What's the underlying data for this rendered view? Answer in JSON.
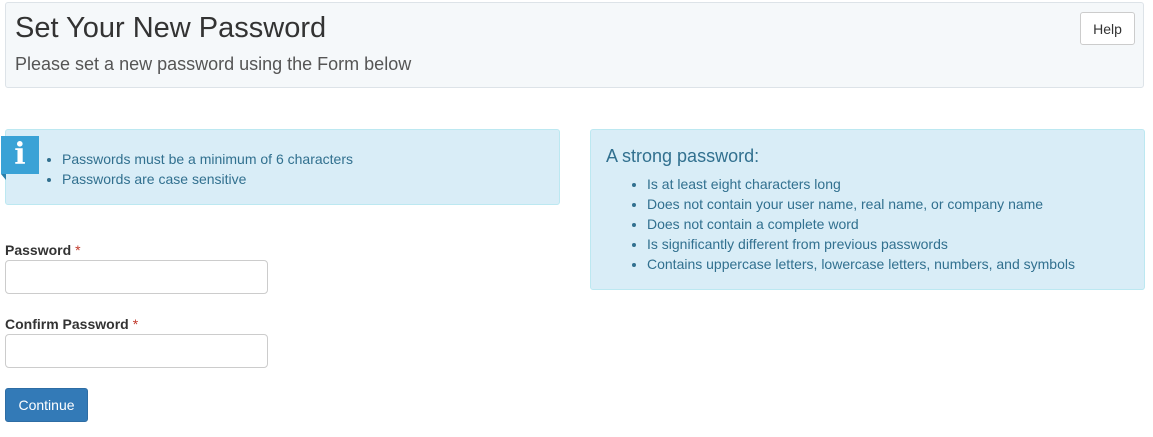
{
  "header": {
    "title": "Set Your New Password",
    "subtitle": "Please set a new password using the Form below",
    "help_label": "Help"
  },
  "info": {
    "icon": "info-icon",
    "icon_glyph": "i",
    "items": [
      "Passwords must be a minimum of 6 characters",
      "Passwords are case sensitive"
    ]
  },
  "strong_password": {
    "title": "A strong password:",
    "items": [
      "Is at least eight characters long",
      "Does not contain your user name, real name, or company name",
      "Does not contain a complete word",
      "Is significantly different from previous passwords",
      "Contains uppercase letters, lowercase letters, numbers, and symbols"
    ]
  },
  "form": {
    "password_label": "Password",
    "password_value": "",
    "confirm_label": "Confirm Password",
    "confirm_value": "",
    "required_marker": "*",
    "continue_label": "Continue"
  },
  "colors": {
    "primary": "#337ab7",
    "info_bg": "#d9edf7",
    "info_text": "#31708f",
    "icon_bg": "#3aa2d6",
    "required": "#c0392b"
  }
}
